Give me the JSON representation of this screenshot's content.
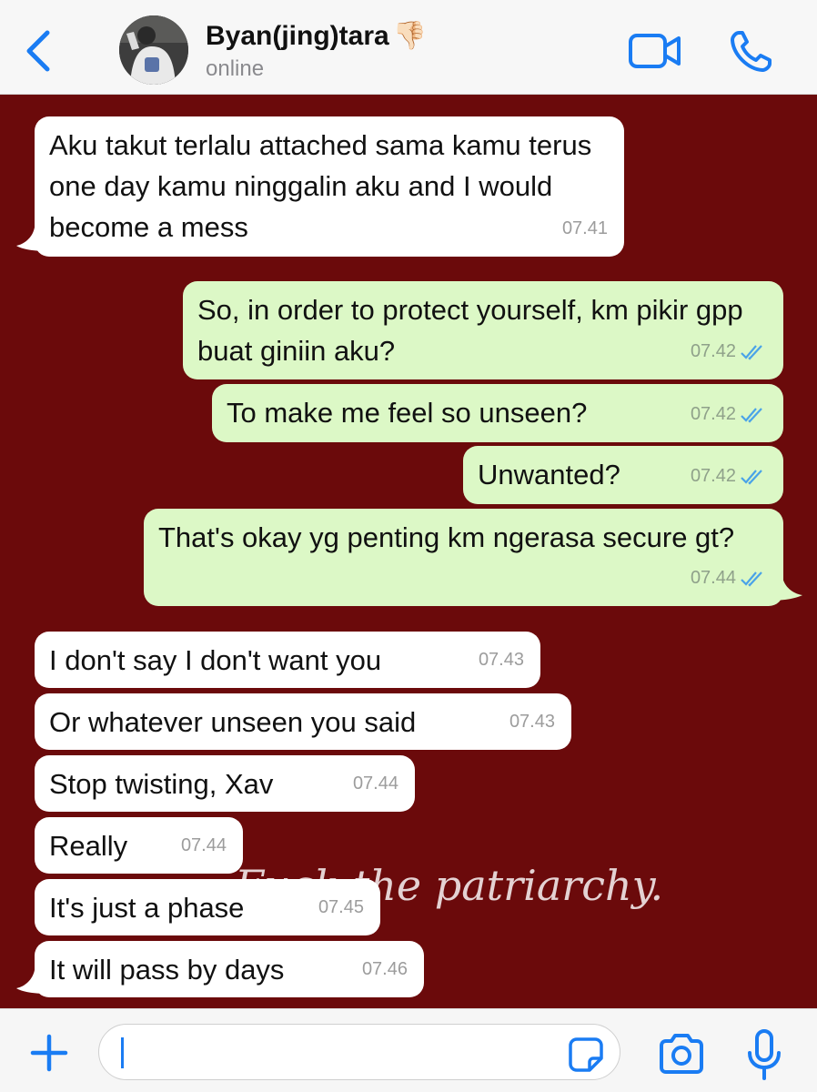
{
  "header": {
    "contact_name": "Byan(jing)tara",
    "name_emoji": "👎🏻",
    "status": "online"
  },
  "theme": {
    "accent": "#1a7cf3",
    "chat_background": "#6b0a0b",
    "incoming_bubble": "#ffffff",
    "outgoing_bubble": "#dcf8c6",
    "read_tick": "#4aa3e8"
  },
  "icons": {
    "back": "chevron-left-icon",
    "video": "video-camera-icon",
    "call": "phone-icon",
    "plus": "plus-icon",
    "sticker": "sticker-icon",
    "camera": "camera-icon",
    "mic": "microphone-icon",
    "read": "double-check-icon"
  },
  "watermark": "Fuck the patriarchy.",
  "messages": [
    {
      "dir": "in",
      "text": "Aku takut terlalu attached sama kamu terus one day kamu ninggalin aku and I would become a mess",
      "time": "07.41"
    },
    {
      "dir": "out",
      "text": "So, in order to protect yourself, km pikir gpp buat giniin aku?",
      "time": "07.42",
      "read": true
    },
    {
      "dir": "out",
      "text": "To make me feel so unseen?",
      "time": "07.42",
      "read": true
    },
    {
      "dir": "out",
      "text": "Unwanted?",
      "time": "07.42",
      "read": true
    },
    {
      "dir": "out",
      "text": "That's okay yg penting km ngerasa secure gt?",
      "time": "07.44",
      "read": true
    },
    {
      "dir": "in",
      "text": "I don't say I don't want you",
      "time": "07.43"
    },
    {
      "dir": "in",
      "text": "Or whatever unseen you said",
      "time": "07.43"
    },
    {
      "dir": "in",
      "text": "Stop twisting, Xav",
      "time": "07.44"
    },
    {
      "dir": "in",
      "text": "Really",
      "time": "07.44"
    },
    {
      "dir": "in",
      "text": "It's just a phase",
      "time": "07.45"
    },
    {
      "dir": "in",
      "text": "It will pass by days",
      "time": "07.46"
    }
  ],
  "composer": {
    "value": ""
  }
}
